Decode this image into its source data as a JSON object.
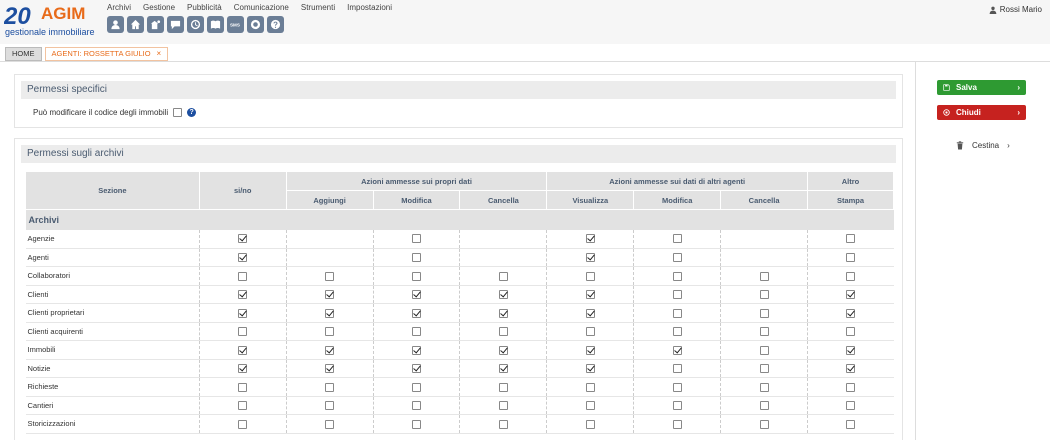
{
  "logo": {
    "number": "20",
    "brand": "AGIM",
    "tagline": "gestionale immobiliare"
  },
  "menu": [
    "Archivi",
    "Gestione",
    "Pubblicità",
    "Comunicazione",
    "Strumenti",
    "Impostazioni"
  ],
  "toolbar_icons": [
    "user-icon",
    "home-icon",
    "building-user-icon",
    "chat-icon",
    "clock-icon",
    "book-icon",
    "sms-icon",
    "support-icon",
    "help-icon"
  ],
  "toolbar_sms": "SMS",
  "user": {
    "name": "Rossi Mario"
  },
  "tabs": {
    "home": "HOME",
    "agent": "AGENTI: ROSSETTA GIULIO",
    "close": "×"
  },
  "specific": {
    "title": "Permessi specifici",
    "label": "Può modificare il codice degli immobili",
    "checked": false,
    "help": "?"
  },
  "archives": {
    "title": "Permessi sugli archivi",
    "headers": {
      "sezione": "Sezione",
      "sino": "si/no",
      "own": "Azioni ammesse sui propri dati",
      "others": "Azioni ammesse sui dati di altri agenti",
      "altro": "Altro",
      "aggiungi": "Aggiungi",
      "modifica": "Modifica",
      "cancella": "Cancella",
      "visualizza": "Visualizza",
      "modifica2": "Modifica",
      "cancella2": "Cancella",
      "stampa": "Stampa"
    },
    "group": "Archivi",
    "rows": [
      {
        "name": "Agenzie",
        "c": [
          1,
          null,
          0,
          null,
          1,
          0,
          null,
          0
        ]
      },
      {
        "name": "Agenti",
        "c": [
          1,
          null,
          0,
          null,
          1,
          0,
          null,
          0
        ]
      },
      {
        "name": "Collaboratori",
        "c": [
          0,
          0,
          0,
          0,
          0,
          0,
          0,
          0
        ]
      },
      {
        "name": "Clienti",
        "c": [
          1,
          1,
          1,
          1,
          1,
          0,
          0,
          1
        ]
      },
      {
        "name": "Clienti proprietari",
        "c": [
          1,
          1,
          1,
          1,
          1,
          0,
          0,
          1
        ]
      },
      {
        "name": "Clienti acquirenti",
        "c": [
          0,
          0,
          0,
          0,
          0,
          0,
          0,
          0
        ]
      },
      {
        "name": "Immobili",
        "c": [
          1,
          1,
          1,
          1,
          1,
          1,
          0,
          1
        ]
      },
      {
        "name": "Notizie",
        "c": [
          1,
          1,
          1,
          1,
          1,
          0,
          0,
          1
        ]
      },
      {
        "name": "Richieste",
        "c": [
          0,
          0,
          0,
          0,
          0,
          0,
          0,
          0
        ]
      },
      {
        "name": "Cantieri",
        "c": [
          0,
          0,
          0,
          0,
          0,
          0,
          0,
          0
        ]
      },
      {
        "name": "Storicizzazioni",
        "c": [
          0,
          0,
          0,
          0,
          0,
          0,
          0,
          0
        ]
      }
    ]
  },
  "sidebar": {
    "save": "Salva",
    "close": "Chiudi",
    "trash": "Cestina",
    "chevron": "›"
  },
  "colors": {
    "save": "#2e9a32",
    "close": "#c6221f",
    "accent": "#e86b1a",
    "brand": "#1d4fa0"
  }
}
